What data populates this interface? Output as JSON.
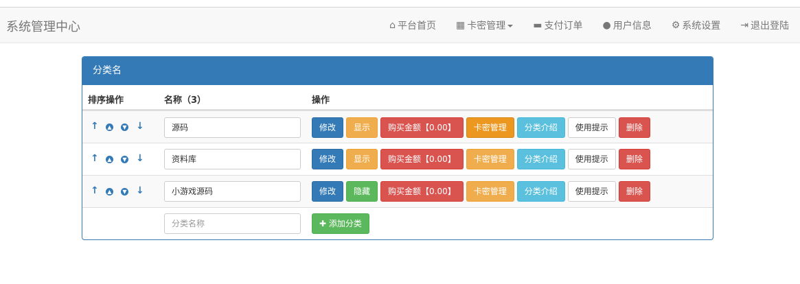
{
  "navbar": {
    "brand": "系统管理中心",
    "items": [
      {
        "label": "平台首页",
        "icon": "home-icon",
        "glyph": "⌂"
      },
      {
        "label": "卡密管理",
        "icon": "grid-icon",
        "glyph": "▦"
      },
      {
        "label": "支付订单",
        "icon": "credit-card-icon",
        "glyph": "▬"
      },
      {
        "label": "用户信息",
        "icon": "user-icon",
        "glyph": "👤"
      },
      {
        "label": "系统设置",
        "icon": "gear-icon",
        "glyph": "⚙"
      },
      {
        "label": "退出登陆",
        "icon": "logout-icon",
        "glyph": "⇥"
      }
    ]
  },
  "panel": {
    "title": "分类名",
    "headers": {
      "sort": "排序操作",
      "name": "名称（3）",
      "actions": "操作"
    },
    "rows": [
      {
        "name": "源码",
        "toggle": "显示",
        "price": "购买金额【0.00】"
      },
      {
        "name": "资料库",
        "toggle": "显示",
        "price": "购买金额【0.00】"
      },
      {
        "name": "小游戏源码",
        "toggle": "隐藏",
        "price": "购买金额【0.00】"
      }
    ],
    "buttons": {
      "edit": "修改",
      "card": "卡密管理",
      "intro": "分类介绍",
      "tips": "使用提示",
      "delete": "删除"
    },
    "new_category": {
      "placeholder": "分类名称",
      "add_label": "添加分类"
    }
  }
}
